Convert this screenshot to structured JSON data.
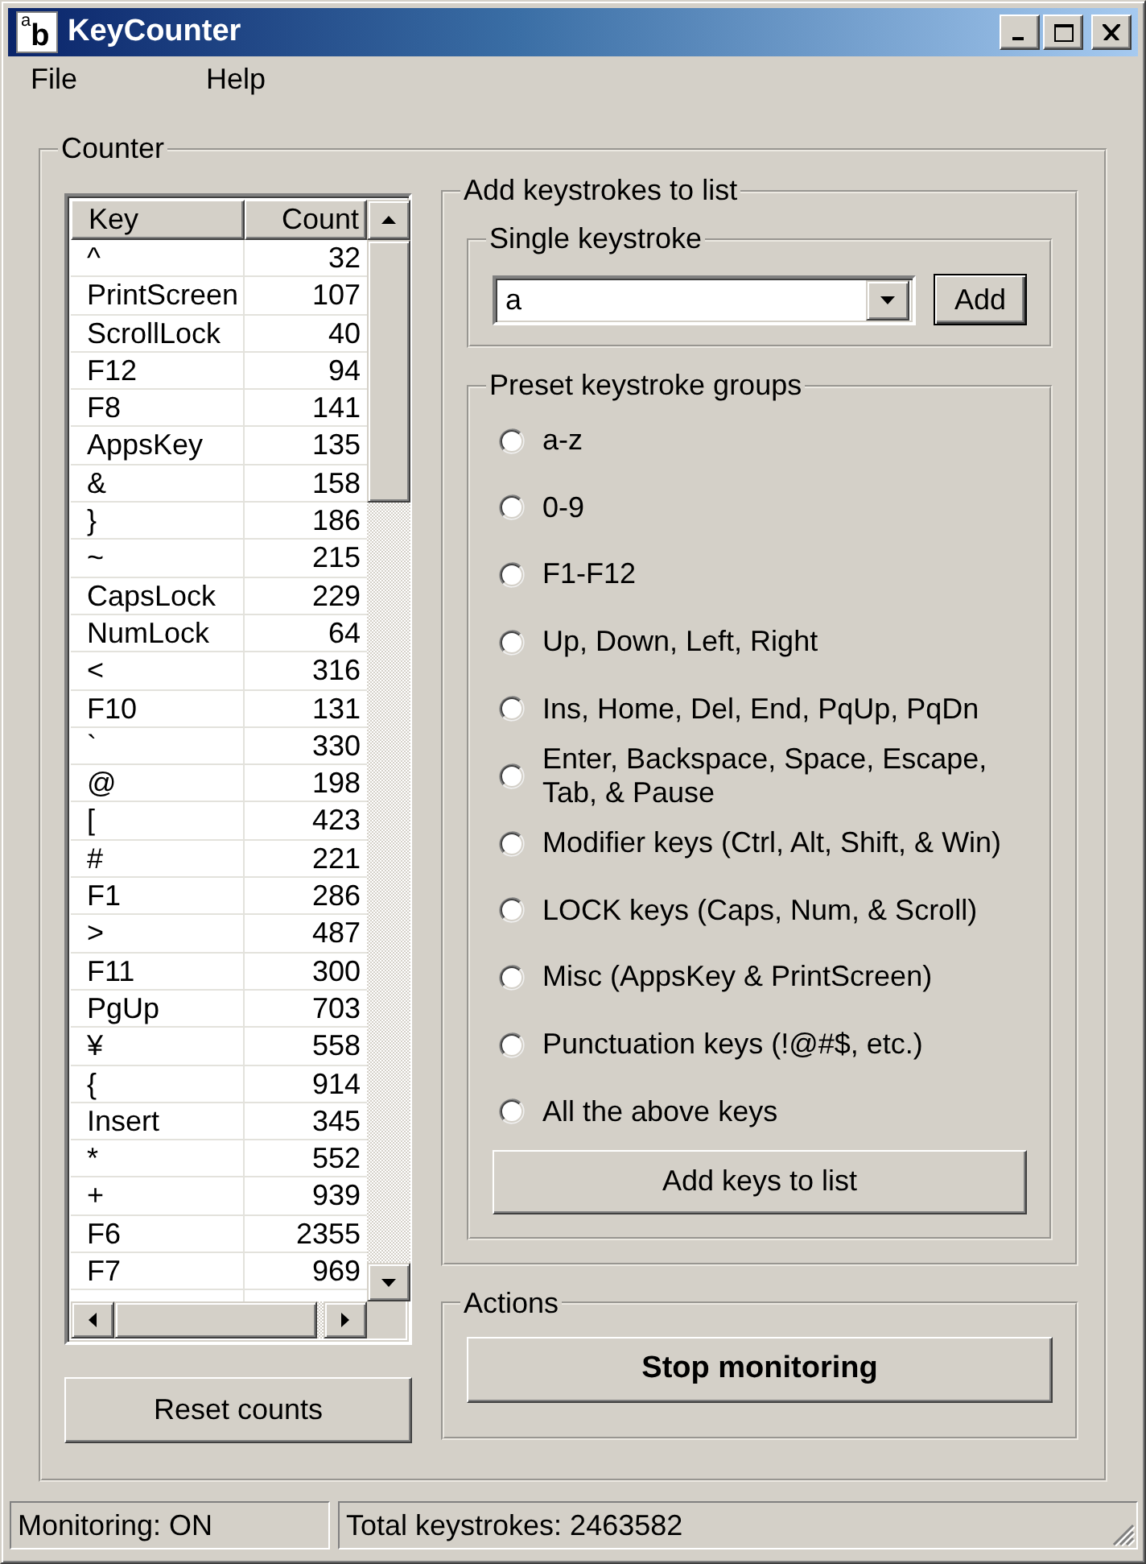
{
  "window": {
    "title": "KeyCounter",
    "icon_letters": [
      "a",
      "b"
    ]
  },
  "menu": [
    {
      "label": "File"
    },
    {
      "label": "Help"
    }
  ],
  "counter_group": {
    "title": "Counter",
    "list": {
      "columns": [
        "Key",
        "Count"
      ],
      "rows": [
        {
          "key": "^",
          "count": "32"
        },
        {
          "key": "PrintScreen",
          "count": "107"
        },
        {
          "key": "ScrollLock",
          "count": "40"
        },
        {
          "key": "F12",
          "count": "94"
        },
        {
          "key": "F8",
          "count": "141"
        },
        {
          "key": "AppsKey",
          "count": "135"
        },
        {
          "key": "&",
          "count": "158"
        },
        {
          "key": "}",
          "count": "186"
        },
        {
          "key": "~",
          "count": "215"
        },
        {
          "key": "CapsLock",
          "count": "229"
        },
        {
          "key": "NumLock",
          "count": "64"
        },
        {
          "key": "<",
          "count": "316"
        },
        {
          "key": "F10",
          "count": "131"
        },
        {
          "key": "`",
          "count": "330"
        },
        {
          "key": "@",
          "count": "198"
        },
        {
          "key": "[",
          "count": "423"
        },
        {
          "key": "#",
          "count": "221"
        },
        {
          "key": "F1",
          "count": "286"
        },
        {
          "key": ">",
          "count": "487"
        },
        {
          "key": "F11",
          "count": "300"
        },
        {
          "key": "PgUp",
          "count": "703"
        },
        {
          "key": "¥",
          "count": "558"
        },
        {
          "key": "{",
          "count": "914"
        },
        {
          "key": "Insert",
          "count": "345"
        },
        {
          "key": "*",
          "count": "552"
        },
        {
          "key": "+",
          "count": "939"
        },
        {
          "key": "F6",
          "count": "2355"
        },
        {
          "key": "F7",
          "count": "969"
        }
      ]
    },
    "reset_button": "Reset counts"
  },
  "add_group": {
    "title": "Add keystrokes to list",
    "single": {
      "title": "Single keystroke",
      "value": "a",
      "button": "Add"
    },
    "presets": {
      "title": "Preset keystroke groups",
      "options": [
        {
          "label": "a-z",
          "selected": false
        },
        {
          "label": "0-9",
          "selected": false
        },
        {
          "label": "F1-F12",
          "selected": false
        },
        {
          "label": "Up, Down, Left, Right",
          "selected": false
        },
        {
          "label": "Ins, Home, Del, End, PqUp, PqDn",
          "selected": false
        },
        {
          "label": "Enter, Backspace, Space, Escape, Tab, & Pause",
          "selected": false
        },
        {
          "label": "Modifier keys (Ctrl, Alt, Shift, & Win)",
          "selected": false
        },
        {
          "label": "LOCK keys (Caps, Num, & Scroll)",
          "selected": false
        },
        {
          "label": "Misc (AppsKey & PrintScreen)",
          "selected": false
        },
        {
          "label": "Punctuation keys (!@#$, etc.)",
          "selected": false
        },
        {
          "label": "All the above keys",
          "selected": false
        }
      ],
      "button": "Add keys to list"
    }
  },
  "actions": {
    "title": "Actions",
    "button": "Stop monitoring"
  },
  "status_bar": [
    "Monitoring: ON",
    "Total keystrokes: 2463582"
  ]
}
